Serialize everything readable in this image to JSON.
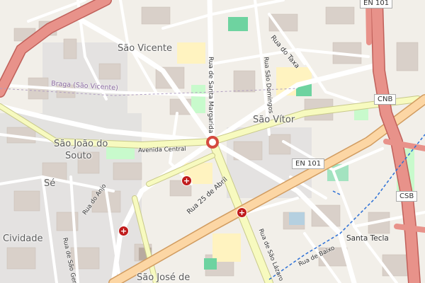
{
  "map": {
    "places": {
      "sao_vicente": "São Vicente",
      "sao_vitor": "São Vítor",
      "sao_joao_do_souto_1": "São João do",
      "sao_joao_do_souto_2": "Souto",
      "se": "Sé",
      "cividade": "Cividade",
      "sao_jose_de": "São José de",
      "santa_tecla": "Santa Tecla"
    },
    "streets": {
      "braga_sao_vicente": "Braga (São Vicente)",
      "rua_do_taxa": "Rua do Taxa",
      "rua_sao_domingos": "Rua São Domingos",
      "rua_de_santa_margarida": "Rua de Santa Margarida",
      "avenida_central": "Avenida Central",
      "rua_25_de_abril": "Rua 25 de Abril",
      "rua_do_anjo": "Rua do Anjo",
      "rua_de_sao_geraldo": "Rua de São Geraldo",
      "rua_de_baixo": "Rua de Baixo",
      "rua_de_sao_lazaro": "Rua de São Lázaro"
    },
    "refs": {
      "en101_top": "EN 101",
      "en101_mid": "EN 101",
      "cnb": "CNB",
      "csb": "CSB"
    },
    "pharmacy_symbol": "+",
    "colors": {
      "motorway": "#e8928a",
      "primary": "#fcd6a4",
      "secondary": "#f7fabf",
      "park": "#c8facc",
      "school": "#fff3c0",
      "building": "#d9d0c9",
      "pharmacy": "#c01c1c",
      "rail_blue": "#2b6fd6"
    }
  }
}
